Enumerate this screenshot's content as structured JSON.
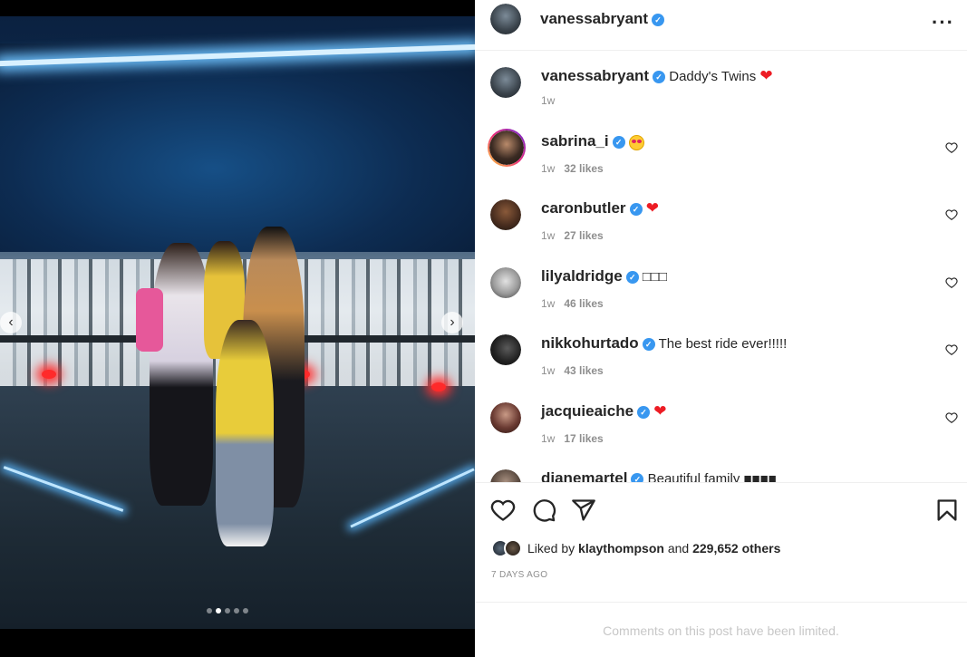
{
  "post": {
    "author": "vanessabryant",
    "caption_author": "vanessabryant",
    "caption": "Daddy's Twins",
    "caption_age": "1w",
    "carousel_dots": 5,
    "carousel_active": 1
  },
  "comments": [
    {
      "user": "sabrina_i",
      "text": "",
      "emoji": "heart-eyes",
      "age": "1w",
      "likes": "32 likes"
    },
    {
      "user": "caronbutler",
      "text": "",
      "emoji": "red-heart",
      "age": "1w",
      "likes": "27 likes"
    },
    {
      "user": "lilyaldridge",
      "text": "□□□",
      "emoji": "",
      "age": "1w",
      "likes": "46 likes"
    },
    {
      "user": "nikkohurtado",
      "text": "The best ride ever!!!!!",
      "emoji": "",
      "age": "1w",
      "likes": "43 likes"
    },
    {
      "user": "jacquieaiche",
      "text": "",
      "emoji": "red-heart",
      "age": "1w",
      "likes": "17 likes"
    },
    {
      "user": "dianemartel",
      "text": "Beautiful family ■■■■",
      "emoji": "",
      "age": "",
      "likes": ""
    }
  ],
  "likes": {
    "prefix": "Liked by",
    "user": "klaythompson",
    "and": "and",
    "others": "229,652 others"
  },
  "timestamp": "7 DAYS AGO",
  "limited_notice": "Comments on this post have been limited.",
  "colors": {
    "verified": "#3897f0",
    "heart": "#ed1c24",
    "meta": "#8e8e8e"
  }
}
